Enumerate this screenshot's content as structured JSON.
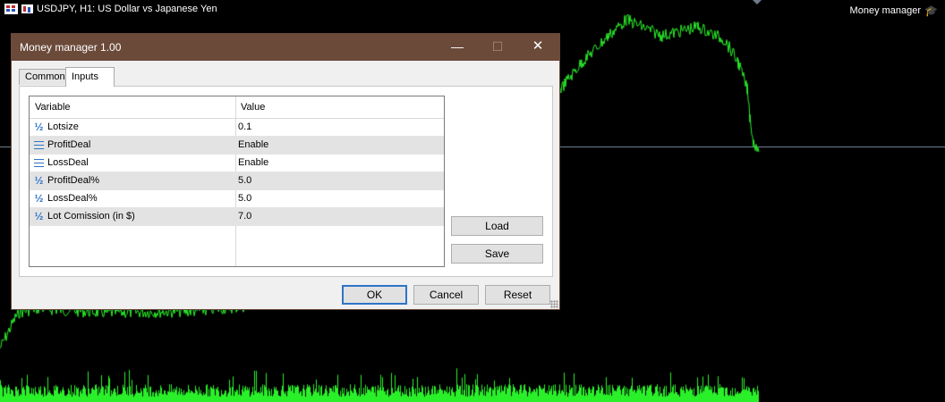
{
  "chart": {
    "title": "USDJPY, H1:  US Dollar vs Japanese Yen",
    "indicator_label": "Money manager",
    "line_color": "#2af02a",
    "hline_color": "#7a8fa0"
  },
  "dialog": {
    "title": "Money manager 1.00",
    "minimize": "—",
    "maximize": "☐",
    "close": "✕",
    "tabs": [
      {
        "label": "Common",
        "active": false
      },
      {
        "label": "Inputs",
        "active": true
      }
    ],
    "columns": {
      "variable": "Variable",
      "value": "Value"
    },
    "rows": [
      {
        "icon": "half-icon",
        "name": "Lotsize",
        "value": "0.1"
      },
      {
        "icon": "list-icon",
        "name": "ProfitDeal",
        "value": "Enable"
      },
      {
        "icon": "list-icon",
        "name": "LossDeal",
        "value": "Enable"
      },
      {
        "icon": "half-icon",
        "name": "ProfitDeal%",
        "value": "5.0"
      },
      {
        "icon": "half-icon",
        "name": "LossDeal%",
        "value": "5.0"
      },
      {
        "icon": "half-icon",
        "name": "Lot Comission (in $)",
        "value": "7.0"
      }
    ],
    "buttons": {
      "load": "Load",
      "save": "Save",
      "ok": "OK",
      "cancel": "Cancel",
      "reset": "Reset"
    },
    "colors": {
      "titlebar": "#6b4a3a",
      "accent": "#2f74c6"
    }
  }
}
